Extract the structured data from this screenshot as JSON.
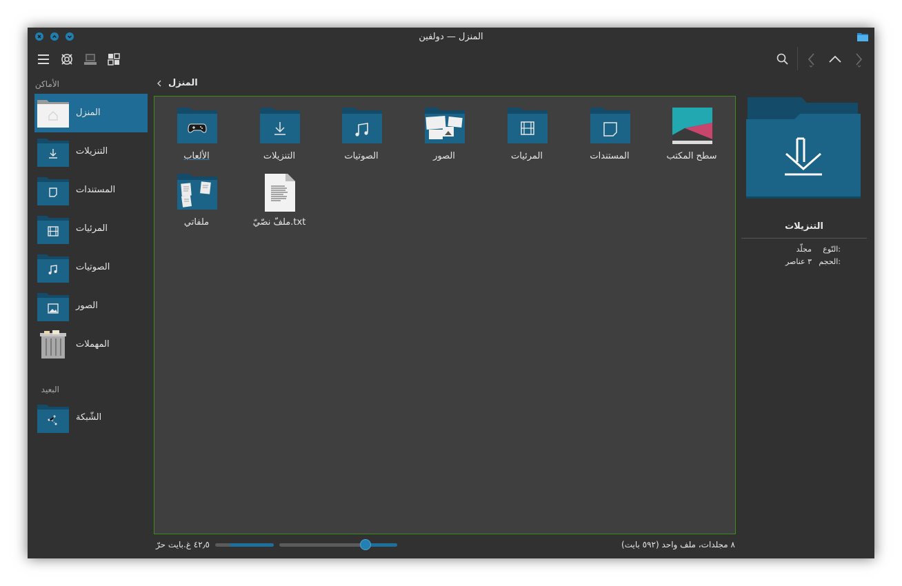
{
  "window": {
    "title": "المنزل — دولفين"
  },
  "toolbar": {
    "menu_icon": "hamburger-menu-icon",
    "split_icon": "split-view-icon",
    "terminal_icon": "terminal-icon",
    "view_mode_icon": "icons-view-icon",
    "search_icon": "search-icon",
    "back_icon": "back-chevron-icon",
    "up_icon": "up-chevron-icon",
    "forward_icon": "forward-chevron-icon"
  },
  "sidebar": {
    "places_header": "الأماكن",
    "remote_header": "البعيد",
    "places": [
      {
        "label": "المنزل",
        "icon": "home-folder-icon",
        "selected": true
      },
      {
        "label": "التنزيلات",
        "icon": "downloads-folder-icon"
      },
      {
        "label": "المستندات",
        "icon": "documents-folder-icon"
      },
      {
        "label": "المرئيات",
        "icon": "videos-folder-icon"
      },
      {
        "label": "الصوتيات",
        "icon": "music-folder-icon"
      },
      {
        "label": "الصور",
        "icon": "pictures-folder-icon"
      },
      {
        "label": "المهملات",
        "icon": "trash-icon"
      }
    ],
    "remote": [
      {
        "label": "الشّبكة",
        "icon": "network-folder-icon"
      }
    ]
  },
  "breadcrumb": {
    "label": "المنزل"
  },
  "files": [
    {
      "label": "سطح المكتب",
      "icon": "desktop-icon"
    },
    {
      "label": "المستندات",
      "icon": "documents-folder-icon"
    },
    {
      "label": "المرئيات",
      "icon": "videos-folder-icon"
    },
    {
      "label": "الصور",
      "icon": "pictures-folder-icon"
    },
    {
      "label": "الصوتيات",
      "icon": "music-folder-icon"
    },
    {
      "label": "التنزيلات",
      "icon": "downloads-folder-icon"
    },
    {
      "label": "الألعاب",
      "icon": "games-folder-icon"
    },
    {
      "label": "ملفاتي",
      "icon": "my-files-folder-icon"
    },
    {
      "label": "ملفّ نصّيّ.txt",
      "icon": "text-file-icon"
    }
  ],
  "info_panel": {
    "title": "التنزيلات",
    "type_label": "النّوع:",
    "type_value": "مجلّد",
    "size_label": "الحجم:",
    "size_value": "٣ عناصر"
  },
  "status": {
    "summary": "٨ مجلدات، ملف واحد (٥٩٢ بايت)",
    "free_space": "٤٢٫٥ غ.بايت حرّ",
    "free_space_fraction": 0.75,
    "zoom_level_fraction": 0.27
  },
  "colors": {
    "accent": "#1f6d96",
    "folder": "#1b6488",
    "folder_dark": "#134b68",
    "focus_border": "#3c8c1e"
  }
}
